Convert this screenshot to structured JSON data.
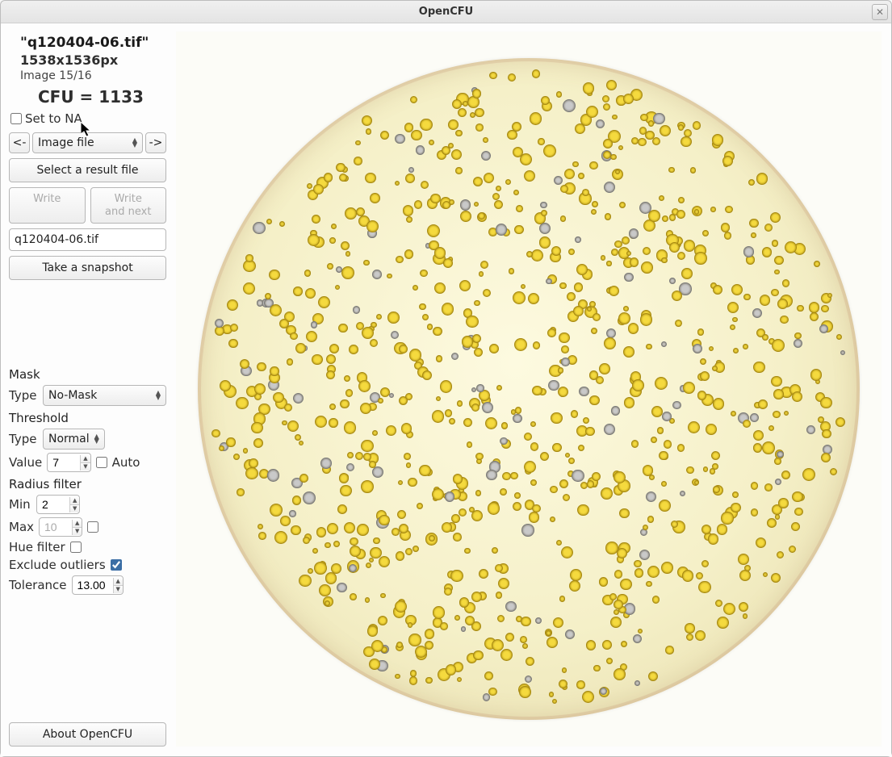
{
  "window": {
    "title": "OpenCFU"
  },
  "info": {
    "filename": "\"q120404-06.tif\"",
    "dimensions": "1538x1536px",
    "index": "Image 15/16",
    "cfu": "CFU = 1133"
  },
  "set_na": {
    "label": "Set to NA",
    "checked": false
  },
  "nav": {
    "prev": "<-",
    "combo": "Image file",
    "next": "->"
  },
  "select_result": "Select a result file",
  "write": "Write",
  "write_next": "Write\nand next",
  "filename_input": "q120404-06.tif",
  "snapshot": "Take a snapshot",
  "mask": {
    "label": "Mask",
    "type_label": "Type",
    "type_value": "No-Mask"
  },
  "threshold": {
    "label": "Threshold",
    "type_label": "Type",
    "type_value": "Normal",
    "value_label": "Value",
    "value": "7",
    "auto_label": "Auto",
    "auto_checked": false
  },
  "radius": {
    "label": "Radius filter",
    "min_label": "Min",
    "min": "2",
    "max_label": "Max",
    "max": "10",
    "max_enabled": false
  },
  "hue": {
    "label": "Hue filter",
    "checked": false
  },
  "outliers": {
    "label": "Exclude outliers",
    "checked": true
  },
  "tolerance": {
    "label": "Tolerance",
    "value": "13.00"
  },
  "about": "About OpenCFU"
}
